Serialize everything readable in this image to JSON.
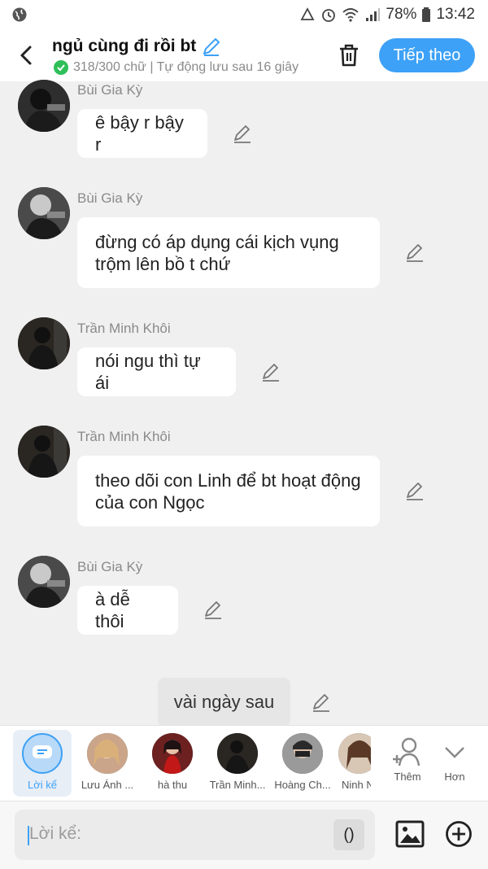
{
  "status_bar": {
    "battery": "78%",
    "time": "13:42"
  },
  "header": {
    "title": "ngủ cùng đi rồi bt",
    "subtitle": "318/300 chữ | Tự động lưu sau 16 giây",
    "next_label": "Tiếp theo"
  },
  "messages": [
    {
      "name": "Bùi Gia Kỳ",
      "text": "ê bậy r bậy r"
    },
    {
      "name": "Bùi Gia Kỳ",
      "text": "đừng có áp dụng cái kịch vụng trộm lên bồ t chứ"
    },
    {
      "name": "Trần Minh Khôi",
      "text": "nói ngu thì tự ái"
    },
    {
      "name": "Trần Minh Khôi",
      "text": "theo dõi con Linh để bt hoạt động của con Ngọc"
    },
    {
      "name": "Bùi Gia Kỳ",
      "text": "à dễ thôi"
    }
  ],
  "narration": {
    "text": "vài ngày sau"
  },
  "characters": [
    {
      "label": "Lời kể"
    },
    {
      "label": "Lưu Ánh ..."
    },
    {
      "label": "hà thu"
    },
    {
      "label": "Trần Minh..."
    },
    {
      "label": "Hoàng Ch..."
    },
    {
      "label": "Ninh N"
    }
  ],
  "char_actions": {
    "add_label": "Thêm",
    "more_label": "Hơn"
  },
  "input": {
    "placeholder": "Lời kể:",
    "paren_label": "()"
  },
  "colors": {
    "accent": "#3da1f7",
    "check": "#2fbf5a"
  },
  "icons": [
    "back-icon",
    "pencil-icon",
    "trash-icon",
    "add-person-icon",
    "chevron-down-icon",
    "image-icon",
    "plus-circle-icon"
  ]
}
